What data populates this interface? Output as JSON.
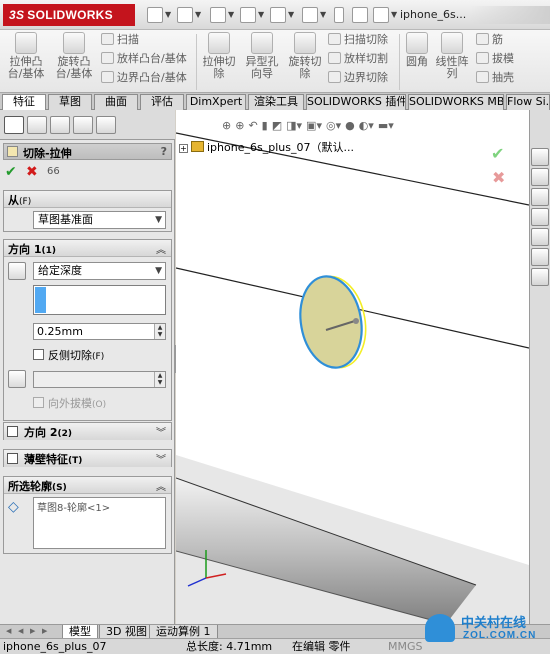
{
  "titlebar": {
    "brand_ds": "3S",
    "brand": "SOLIDWORKS",
    "document_title": "iphone_6s..."
  },
  "ribbon": {
    "extrude_boss": "拉伸凸台/基体",
    "revolve_boss": "旋转凸台/基体",
    "sweep": "扫描",
    "loft_boss": "放样凸台/基体",
    "boundary_boss": "边界凸台/基体",
    "extrude_cut": "拉伸切除",
    "hole_wizard": "异型孔向导",
    "revolve_cut": "旋转切除",
    "swept_cut": "扫描切除",
    "lofted_cut": "放样切割",
    "boundary_cut": "边界切除",
    "fillet": "圆角",
    "linear_pattern": "线性阵列",
    "rib": "筋",
    "draft": "拔模",
    "shell": "抽壳"
  },
  "tabs": [
    "特征",
    "草图",
    "曲面",
    "评估",
    "DimXpert",
    "渲染工具",
    "SOLIDWORKS 插件",
    "SOLIDWORKS MBD",
    "Flow Si..."
  ],
  "panel": {
    "title": "切除-拉伸",
    "help": "?",
    "ok_icon": "✔",
    "cancel_icon": "✖",
    "from": {
      "label": "从",
      "key": "(F)",
      "value": "草图基准面"
    },
    "direction1": {
      "label": "方向 1",
      "key": "(1)",
      "end_condition": "给定深度",
      "depth": "0.25mm",
      "flip_label": "反侧切除",
      "flip_key": "(F)",
      "draft_label": "向外拔模",
      "draft_key": "(O)"
    },
    "direction2": {
      "label": "方向 2",
      "key": "(2)"
    },
    "thin": {
      "label": "薄壁特征",
      "key": "(T)"
    },
    "contours": {
      "label": "所选轮廓",
      "key": "(S)",
      "item": "草图8-轮廓<1>"
    }
  },
  "viewport": {
    "tree_root": "iphone_6s_plus_07（默认..."
  },
  "bottom_tabs": [
    "模型",
    "3D 视图",
    "运动算例 1"
  ],
  "status": {
    "filename": "iphone_6s_plus_07",
    "length": "总长度: 4.71mm",
    "editing": "在编辑 零件",
    "units": "MMGS"
  },
  "watermark": {
    "cn": "中关村在线",
    "url": "ZOL.COM.CN"
  },
  "colors": {
    "accent_red": "#c4141d",
    "selection_blue": "#52a9f2",
    "face_yellow": "#d8d49a",
    "edge_blue": "#2f8fd8"
  }
}
